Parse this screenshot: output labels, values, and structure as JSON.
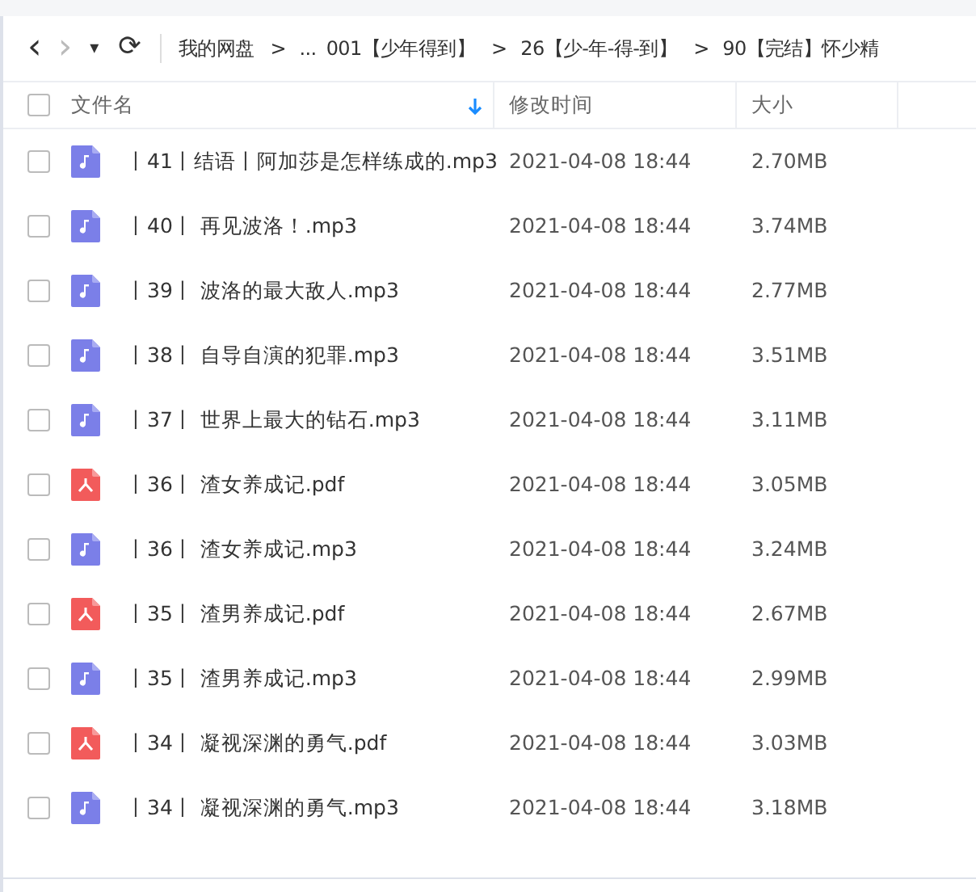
{
  "toolbar": {
    "back": "‹",
    "forward": "›",
    "dropdown": "▾",
    "refresh": "⟳"
  },
  "breadcrumb": [
    {
      "label": "我的网盘",
      "kind": "link"
    },
    {
      "label": ">",
      "kind": "sep"
    },
    {
      "label": "...",
      "kind": "link"
    },
    {
      "label": "001【少年得到】",
      "kind": "link"
    },
    {
      "label": ">",
      "kind": "sep"
    },
    {
      "label": "26【少-年-得-到】",
      "kind": "link"
    },
    {
      "label": ">",
      "kind": "sep"
    },
    {
      "label": "90【完结】怀少精",
      "kind": "link"
    }
  ],
  "table": {
    "columns": [
      {
        "label": "文件名",
        "sorted": true
      },
      {
        "label": "修改时间",
        "sorted": false
      },
      {
        "label": "大小",
        "sorted": false
      }
    ],
    "select_all": false,
    "rows": [
      {
        "kind": "audio",
        "name": "丨41丨结语丨阿加莎是怎样练成的.mp3",
        "modified": "2021-04-08 18:44",
        "size": "2.70MB",
        "checked": false
      },
      {
        "kind": "audio",
        "name": "丨40丨 再见波洛！.mp3",
        "modified": "2021-04-08 18:44",
        "size": "3.74MB",
        "checked": false
      },
      {
        "kind": "audio",
        "name": "丨39丨 波洛的最大敌人.mp3",
        "modified": "2021-04-08 18:44",
        "size": "2.77MB",
        "checked": false
      },
      {
        "kind": "audio",
        "name": "丨38丨 自导自演的犯罪.mp3",
        "modified": "2021-04-08 18:44",
        "size": "3.51MB",
        "checked": false
      },
      {
        "kind": "audio",
        "name": "丨37丨 世界上最大的钻石.mp3",
        "modified": "2021-04-08 18:44",
        "size": "3.11MB",
        "checked": false
      },
      {
        "kind": "pdf",
        "name": "丨36丨 渣女养成记.pdf",
        "modified": "2021-04-08 18:44",
        "size": "3.05MB",
        "checked": false
      },
      {
        "kind": "audio",
        "name": "丨36丨 渣女养成记.mp3",
        "modified": "2021-04-08 18:44",
        "size": "3.24MB",
        "checked": false
      },
      {
        "kind": "pdf",
        "name": "丨35丨 渣男养成记.pdf",
        "modified": "2021-04-08 18:44",
        "size": "2.67MB",
        "checked": false
      },
      {
        "kind": "audio",
        "name": "丨35丨 渣男养成记.mp3",
        "modified": "2021-04-08 18:44",
        "size": "2.99MB",
        "checked": false
      },
      {
        "kind": "pdf",
        "name": "丨34丨 凝视深渊的勇气.pdf",
        "modified": "2021-04-08 18:44",
        "size": "3.03MB",
        "checked": false
      },
      {
        "kind": "audio",
        "name": "丨34丨 凝视深渊的勇气.mp3",
        "modified": "2021-04-08 18:44",
        "size": "3.18MB",
        "checked": false
      }
    ]
  }
}
